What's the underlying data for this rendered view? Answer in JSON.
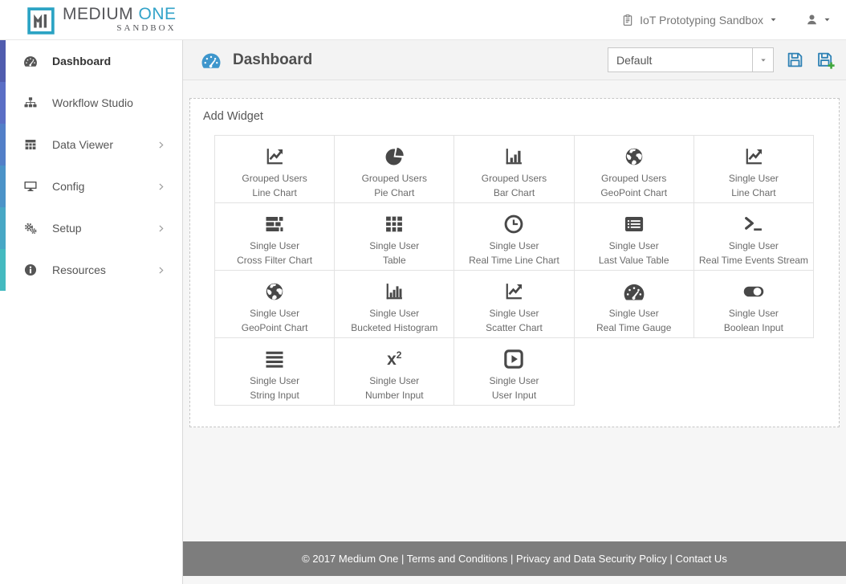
{
  "header": {
    "logo": {
      "mark": "M1",
      "primary": "MEDIUM",
      "accent": "ONE",
      "subtitle": "SANDBOX"
    },
    "sandbox_selector": {
      "label": "IoT Prototyping Sandbox",
      "icon": "clipboard"
    },
    "user_menu": {
      "icon": "person"
    }
  },
  "sidebar": {
    "items": [
      {
        "label": "Dashboard",
        "icon": "gauge",
        "stripe_color": "#505cae",
        "active": true,
        "has_submenu": false
      },
      {
        "label": "Workflow Studio",
        "icon": "sitemap",
        "stripe_color": "#5a6ec5",
        "active": false,
        "has_submenu": false
      },
      {
        "label": "Data Viewer",
        "icon": "table",
        "stripe_color": "#527fc8",
        "active": false,
        "has_submenu": true
      },
      {
        "label": "Config",
        "icon": "desktop",
        "stripe_color": "#4b93c8",
        "active": false,
        "has_submenu": true
      },
      {
        "label": "Setup",
        "icon": "gears",
        "stripe_color": "#47a7c5",
        "active": false,
        "has_submenu": true
      },
      {
        "label": "Resources",
        "icon": "info",
        "stripe_color": "#44bac0",
        "active": false,
        "has_submenu": true
      }
    ]
  },
  "main": {
    "title": "Dashboard",
    "title_icon": "gauge",
    "dashboard_select": {
      "value": "Default"
    },
    "toolbar": {
      "save_icon": "save",
      "save_as_icon": "save-plus"
    },
    "add_widget": {
      "title": "Add Widget",
      "widgets": [
        {
          "group": "Grouped Users",
          "type": "Line Chart",
          "icon": "line-chart"
        },
        {
          "group": "Grouped Users",
          "type": "Pie Chart",
          "icon": "pie-chart"
        },
        {
          "group": "Grouped Users",
          "type": "Bar Chart",
          "icon": "bar-chart"
        },
        {
          "group": "Grouped Users",
          "type": "GeoPoint Chart",
          "icon": "globe"
        },
        {
          "group": "Single User",
          "type": "Line Chart",
          "icon": "line-chart"
        },
        {
          "group": "Single User",
          "type": "Cross Filter Chart",
          "icon": "cross-filter"
        },
        {
          "group": "Single User",
          "type": "Table",
          "icon": "table-grid"
        },
        {
          "group": "Single User",
          "type": "Real Time Line Chart",
          "icon": "clock"
        },
        {
          "group": "Single User",
          "type": "Last Value Table",
          "icon": "list-table"
        },
        {
          "group": "Single User",
          "type": "Real Time Events Stream",
          "icon": "terminal"
        },
        {
          "group": "Single User",
          "type": "GeoPoint Chart",
          "icon": "globe"
        },
        {
          "group": "Single User",
          "type": "Bucketed Histogram",
          "icon": "histogram"
        },
        {
          "group": "Single User",
          "type": "Scatter Chart",
          "icon": "line-chart"
        },
        {
          "group": "Single User",
          "type": "Real Time Gauge",
          "icon": "gauge"
        },
        {
          "group": "Single User",
          "type": "Boolean Input",
          "icon": "toggle"
        },
        {
          "group": "Single User",
          "type": "String Input",
          "icon": "align-justify"
        },
        {
          "group": "Single User",
          "type": "Number Input",
          "icon": "x-squared"
        },
        {
          "group": "Single User",
          "type": "User Input",
          "icon": "play-square"
        }
      ]
    }
  },
  "footer": {
    "copyright": "© 2017 Medium One",
    "separator": "|",
    "links": [
      "Terms and Conditions",
      "Privacy and Data Security Policy",
      "Contact Us"
    ]
  },
  "colors": {
    "brand_teal": "#2ba3c4",
    "brand_blue": "#33a3c9",
    "title_icon_blue": "#3e96cc",
    "save_icon_blue": "#2f82b5",
    "save_plus_green": "#3fa73c",
    "footer_gray": "#7d7d7d"
  }
}
